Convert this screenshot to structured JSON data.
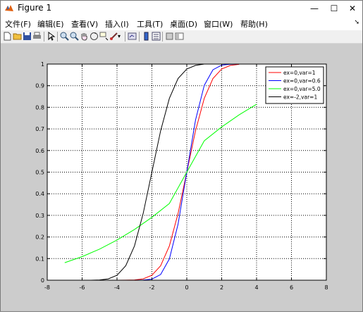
{
  "window": {
    "title": "Figure 1",
    "buttons": {
      "minimize": "—",
      "maximize": "☐",
      "close": "✕"
    }
  },
  "menu": {
    "items": [
      "文件(F)",
      "编辑(E)",
      "查看(V)",
      "插入(I)",
      "工具(T)",
      "桌面(D)",
      "窗口(W)",
      "帮助(H)"
    ]
  },
  "toolbar": {
    "icons": [
      "new-figure-icon",
      "open-file-icon",
      "save-icon",
      "print-icon",
      "select-arrow-icon",
      "zoom-in-icon",
      "zoom-out-icon",
      "pan-hand-icon",
      "rotate-3d-icon",
      "data-cursor-icon",
      "brush-icon",
      "brush-dropdown-icon",
      "link-plot-icon",
      "colorbar-icon",
      "legend-icon",
      "hide-plot-tools-icon",
      "show-plot-tools-icon"
    ]
  },
  "chart_data": {
    "type": "line",
    "title": "",
    "xlabel": "",
    "ylabel": "",
    "xlim": [
      -8,
      8
    ],
    "ylim": [
      0,
      1
    ],
    "xticks": [
      "-8",
      "-6",
      "-4",
      "-2",
      "0",
      "2",
      "4",
      "6",
      "8"
    ],
    "yticks": [
      "0",
      "0.1",
      "0.2",
      "0.3",
      "0.4",
      "0.5",
      "0.6",
      "0.7",
      "0.8",
      "0.9",
      "1"
    ],
    "grid": true,
    "grid_style": "dotted",
    "legend_position": "top-right",
    "series": [
      {
        "name": "ex=0,var=1",
        "color": "#ff0000",
        "x": [
          -7,
          -6,
          -5,
          -4,
          -3.5,
          -3,
          -2.5,
          -2,
          -1.5,
          -1,
          -0.5,
          0,
          0.5,
          1,
          1.5,
          2,
          2.5,
          3
        ],
        "y": [
          0,
          0,
          0,
          0,
          0.0002,
          0.0013,
          0.0062,
          0.0228,
          0.0668,
          0.1587,
          0.3085,
          0.5,
          0.6915,
          0.8413,
          0.9332,
          0.9772,
          0.9938,
          0.9987
        ]
      },
      {
        "name": "ex=0,var=0.6",
        "color": "#0000ff",
        "x": [
          -7,
          -6,
          -5,
          -4,
          -3,
          -2.5,
          -2,
          -1.5,
          -1,
          -0.5,
          0,
          0.5,
          1,
          1.5,
          2,
          2.5,
          3
        ],
        "y": [
          0,
          0,
          0,
          0,
          0.0001,
          0.0006,
          0.0049,
          0.0264,
          0.0984,
          0.2588,
          0.5,
          0.7412,
          0.9016,
          0.9736,
          0.9951,
          0.9994,
          1
        ]
      },
      {
        "name": "ex=0,var=5.0",
        "color": "#00ff00",
        "x": [
          -7,
          -6,
          -5,
          -4,
          -3,
          -2,
          -1,
          0,
          1,
          2,
          3,
          4
        ],
        "y": [
          0.081,
          0.109,
          0.144,
          0.186,
          0.235,
          0.291,
          0.355,
          0.5,
          0.645,
          0.709,
          0.765,
          0.814
        ]
      },
      {
        "name": "ex=-2,var=1",
        "color": "#000000",
        "x": [
          -7,
          -6,
          -5.5,
          -5,
          -4.5,
          -4,
          -3.5,
          -3,
          -2.5,
          -2,
          -1.5,
          -1,
          -0.5,
          0,
          0.5,
          1
        ],
        "y": [
          0,
          0,
          0,
          0.0013,
          0.0062,
          0.0228,
          0.0668,
          0.1587,
          0.3085,
          0.5,
          0.6915,
          0.8413,
          0.9332,
          0.9772,
          0.9938,
          1
        ]
      }
    ]
  }
}
